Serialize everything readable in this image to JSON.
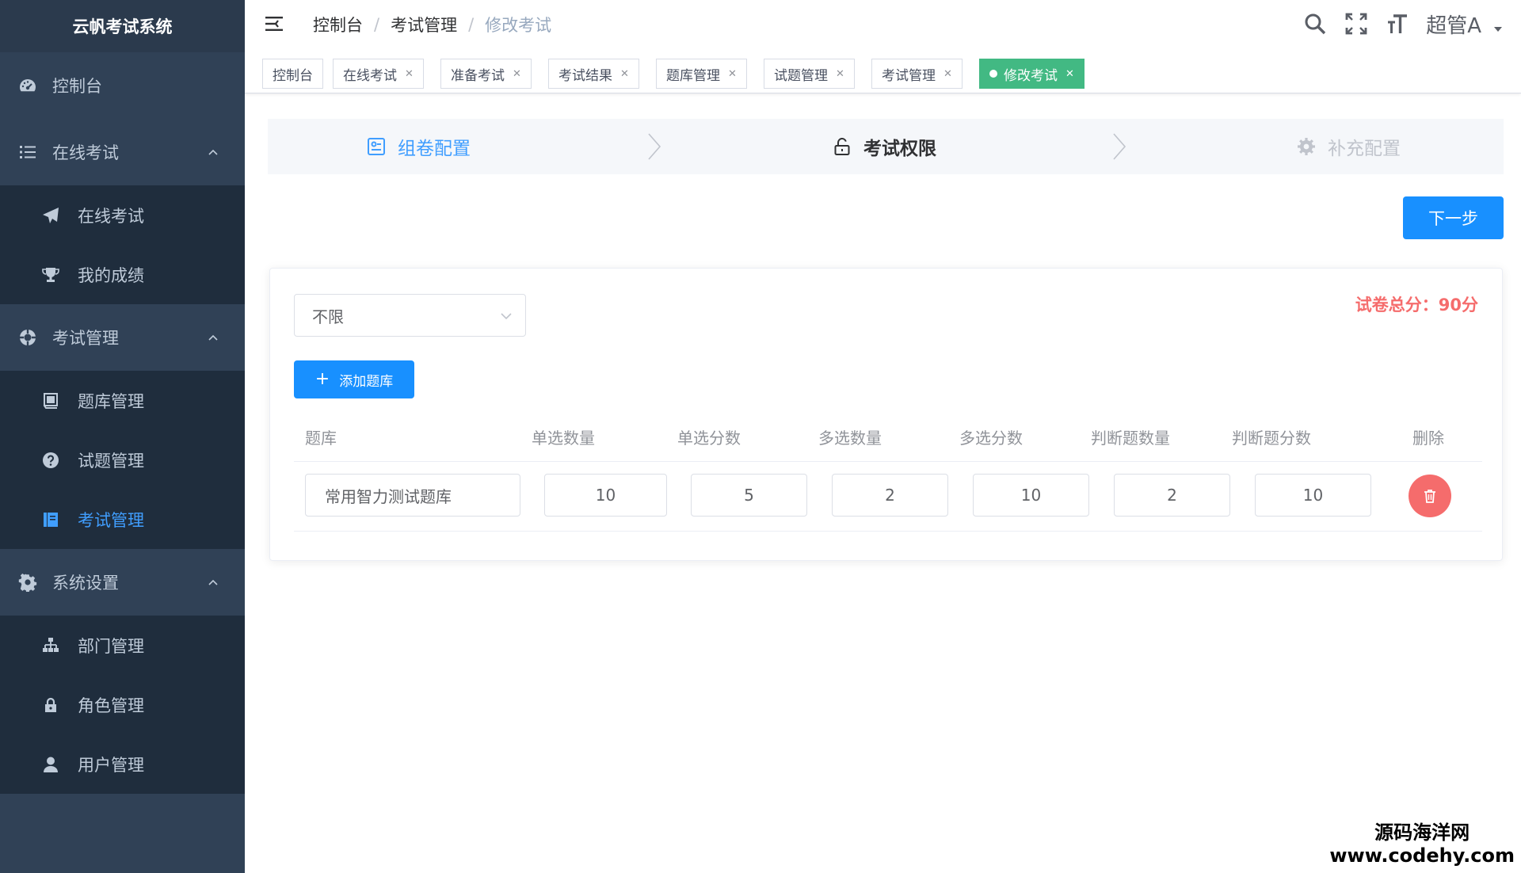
{
  "app": {
    "title": "云帆考试系统"
  },
  "sidebar": {
    "items": [
      {
        "label": "控制台",
        "icon": "dashboard-icon"
      },
      {
        "label": "在线考试",
        "icon": "list-icon",
        "children": [
          {
            "label": "在线考试",
            "icon": "paper-plane-icon"
          },
          {
            "label": "我的成绩",
            "icon": "trophy-icon"
          }
        ]
      },
      {
        "label": "考试管理",
        "icon": "lifebuoy-icon",
        "children": [
          {
            "label": "题库管理",
            "icon": "book-icon"
          },
          {
            "label": "试题管理",
            "icon": "question-icon"
          },
          {
            "label": "考试管理",
            "icon": "notebook-icon",
            "active": true
          }
        ]
      },
      {
        "label": "系统设置",
        "icon": "gear-icon",
        "children": [
          {
            "label": "部门管理",
            "icon": "sitemap-icon"
          },
          {
            "label": "角色管理",
            "icon": "lock-icon"
          },
          {
            "label": "用户管理",
            "icon": "user-icon"
          }
        ]
      }
    ]
  },
  "header": {
    "breadcrumb": [
      "控制台",
      "考试管理",
      "修改考试"
    ],
    "user": "超管A"
  },
  "tags": [
    {
      "label": "控制台",
      "closable": false
    },
    {
      "label": "在线考试",
      "closable": true
    },
    {
      "label": "准备考试",
      "closable": true
    },
    {
      "label": "考试结果",
      "closable": true
    },
    {
      "label": "题库管理",
      "closable": true
    },
    {
      "label": "试题管理",
      "closable": true
    },
    {
      "label": "考试管理",
      "closable": true
    },
    {
      "label": "修改考试",
      "closable": true,
      "active": true
    }
  ],
  "steps": [
    {
      "label": "组卷配置",
      "status": "done"
    },
    {
      "label": "考试权限",
      "status": "current"
    },
    {
      "label": "补充配置",
      "status": "wait"
    }
  ],
  "next_button": "下一步",
  "form": {
    "select_value": "不限",
    "total_score_label": "试卷总分：90分",
    "add_button": "添加题库"
  },
  "table": {
    "columns": [
      "题库",
      "单选数量",
      "单选分数",
      "多选数量",
      "多选分数",
      "判断题数量",
      "判断题分数",
      "删除"
    ],
    "rows": [
      {
        "repo": "常用智力测试题库",
        "radio_count": "10",
        "radio_score": "5",
        "multi_count": "2",
        "multi_score": "10",
        "judge_count": "2",
        "judge_score": "10"
      }
    ]
  },
  "watermark": {
    "line1": "源码海洋网",
    "line2": "www.codehy.com"
  },
  "colors": {
    "sidebar_bg": "#304156",
    "primary": "#1890ff",
    "active_tag": "#42b983",
    "danger": "#f56c6c"
  }
}
